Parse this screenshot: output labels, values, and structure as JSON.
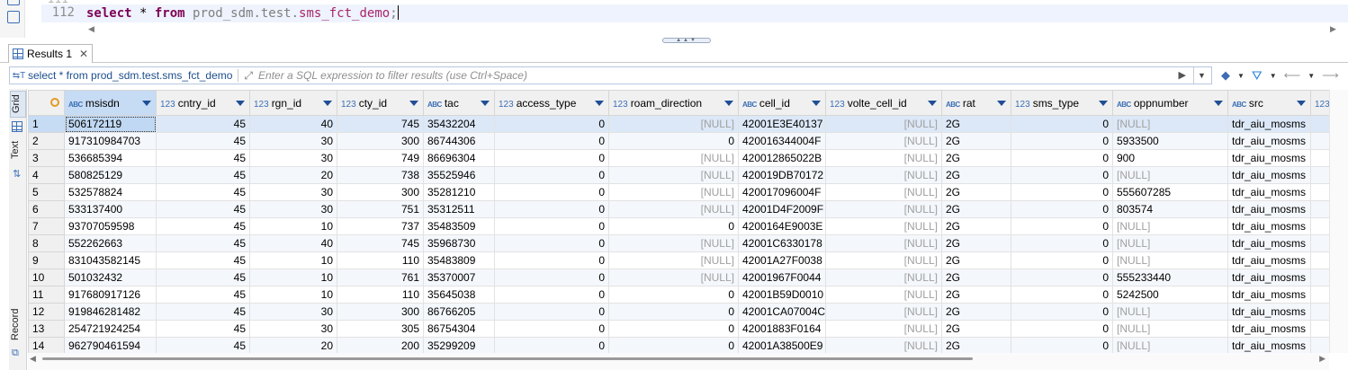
{
  "editor": {
    "prev_line_number": "111",
    "line_number": "112",
    "sql_keyword_select": "select",
    "sql_star": " * ",
    "sql_keyword_from": "from",
    "sql_table_prefix": " prod_sdm.test.",
    "sql_table_name": "sms_fct_demo",
    "sql_end": ";"
  },
  "results_tab": {
    "label": "Results 1",
    "close": "✕"
  },
  "filter": {
    "query": "select * from prod_sdm.test.sms_fct_demo",
    "placeholder": "Enter a SQL expression to filter results (use Ctrl+Space)"
  },
  "side_panel": {
    "grid_tab": "Grid",
    "text_tab": "Text",
    "record_tab": "Record"
  },
  "grid": {
    "columns": [
      {
        "name": "msisdn",
        "type": "ABC"
      },
      {
        "name": "cntry_id",
        "type": "123"
      },
      {
        "name": "rgn_id",
        "type": "123"
      },
      {
        "name": "cty_id",
        "type": "123"
      },
      {
        "name": "tac",
        "type": "ABC"
      },
      {
        "name": "access_type",
        "type": "123"
      },
      {
        "name": "roam_direction",
        "type": "123"
      },
      {
        "name": "cell_id",
        "type": "ABC"
      },
      {
        "name": "volte_cell_id",
        "type": "123"
      },
      {
        "name": "rat",
        "type": "ABC"
      },
      {
        "name": "sms_type",
        "type": "123"
      },
      {
        "name": "oppnumber",
        "type": "ABC"
      },
      {
        "name": "src",
        "type": "ABC"
      },
      {
        "name": "",
        "type": "123"
      }
    ],
    "rows": [
      [
        "1",
        "506172119",
        "45",
        "40",
        "745",
        "35432204",
        "0",
        "[NULL]",
        "42001E3E40137",
        "[NULL]",
        "2G",
        "0",
        "[NULL]",
        "tdr_aiu_mosms"
      ],
      [
        "2",
        "917310984703",
        "45",
        "30",
        "300",
        "86744306",
        "0",
        "0",
        "420016344004F",
        "[NULL]",
        "2G",
        "0",
        "5933500",
        "tdr_aiu_mosms"
      ],
      [
        "3",
        "536685394",
        "45",
        "30",
        "749",
        "86696304",
        "0",
        "[NULL]",
        "420012865022B",
        "[NULL]",
        "2G",
        "0",
        "900",
        "tdr_aiu_mosms"
      ],
      [
        "4",
        "580825129",
        "45",
        "20",
        "738",
        "35525946",
        "0",
        "[NULL]",
        "420019DB70172",
        "[NULL]",
        "2G",
        "0",
        "[NULL]",
        "tdr_aiu_mosms"
      ],
      [
        "5",
        "532578824",
        "45",
        "30",
        "300",
        "35281210",
        "0",
        "[NULL]",
        "420017096004F",
        "[NULL]",
        "2G",
        "0",
        "555607285",
        "tdr_aiu_mosms"
      ],
      [
        "6",
        "533137400",
        "45",
        "30",
        "751",
        "35312511",
        "0",
        "[NULL]",
        "42001D4F2009F",
        "[NULL]",
        "2G",
        "0",
        "803574",
        "tdr_aiu_mosms"
      ],
      [
        "7",
        "93707059598",
        "45",
        "10",
        "737",
        "35483509",
        "0",
        "0",
        "4200164E9003E",
        "[NULL]",
        "2G",
        "0",
        "[NULL]",
        "tdr_aiu_mosms"
      ],
      [
        "8",
        "552262663",
        "45",
        "40",
        "745",
        "35968730",
        "0",
        "[NULL]",
        "42001C6330178",
        "[NULL]",
        "2G",
        "0",
        "[NULL]",
        "tdr_aiu_mosms"
      ],
      [
        "9",
        "831043582145",
        "45",
        "10",
        "110",
        "35483809",
        "0",
        "[NULL]",
        "42001A27F0038",
        "[NULL]",
        "2G",
        "0",
        "[NULL]",
        "tdr_aiu_mosms"
      ],
      [
        "10",
        "501032432",
        "45",
        "10",
        "761",
        "35370007",
        "0",
        "[NULL]",
        "42001967F0044",
        "[NULL]",
        "2G",
        "0",
        "555233440",
        "tdr_aiu_mosms"
      ],
      [
        "11",
        "917680917126",
        "45",
        "10",
        "110",
        "35645038",
        "0",
        "0",
        "42001B59D0010",
        "[NULL]",
        "2G",
        "0",
        "5242500",
        "tdr_aiu_mosms"
      ],
      [
        "12",
        "919846281482",
        "45",
        "30",
        "300",
        "86766205",
        "0",
        "0",
        "42001CA07004C",
        "[NULL]",
        "2G",
        "0",
        "[NULL]",
        "tdr_aiu_mosms"
      ],
      [
        "13",
        "254721924254",
        "45",
        "30",
        "305",
        "86754304",
        "0",
        "0",
        "42001883F0164",
        "[NULL]",
        "2G",
        "0",
        "[NULL]",
        "tdr_aiu_mosms"
      ],
      [
        "14",
        "962790461594",
        "45",
        "20",
        "200",
        "35299209",
        "0",
        "0",
        "42001A38500E9",
        "[NULL]",
        "2G",
        "0",
        "[NULL]",
        "tdr_aiu_mosms"
      ]
    ]
  }
}
